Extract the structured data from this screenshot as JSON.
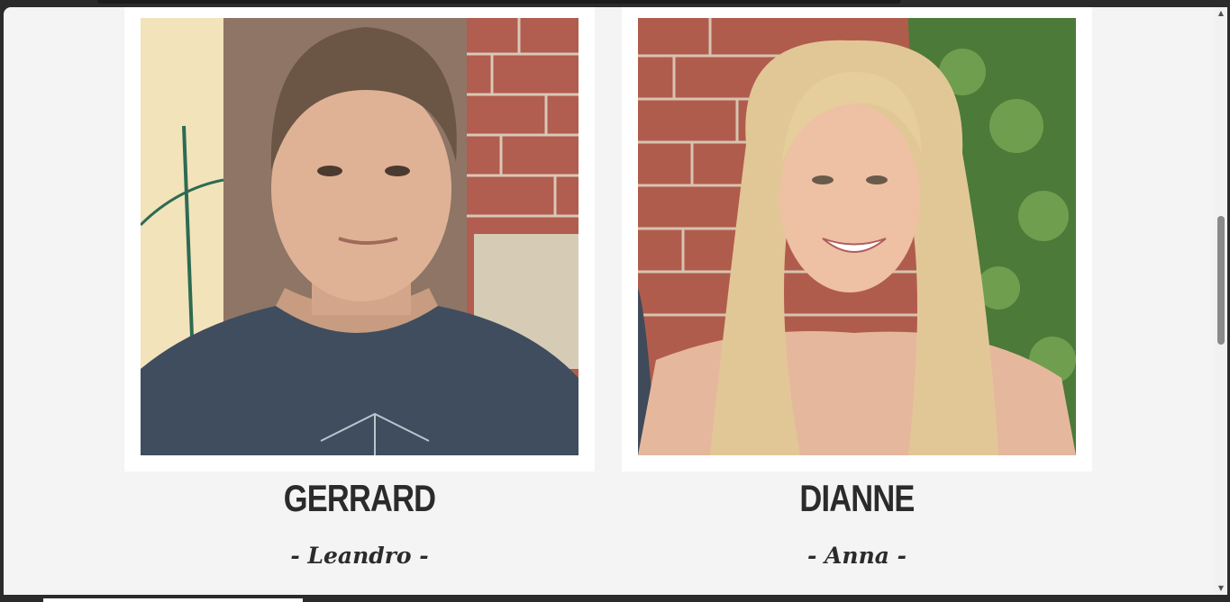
{
  "team": {
    "members": [
      {
        "name": "GERRARD",
        "nickname": "- Leandro -",
        "photo_icon": "portrait-man-photo"
      },
      {
        "name": "DIANNE",
        "nickname": "- Anna -",
        "photo_icon": "portrait-woman-photo"
      }
    ]
  },
  "colors": {
    "page_background": "#f4f4f4",
    "card_frame": "#ffffff",
    "text": "#2b2b2b",
    "scroll_thumb": "#8a8a8a"
  },
  "scrollbar": {
    "up_icon": "scroll-up-arrow-icon",
    "down_icon": "scroll-down-arrow-icon"
  }
}
